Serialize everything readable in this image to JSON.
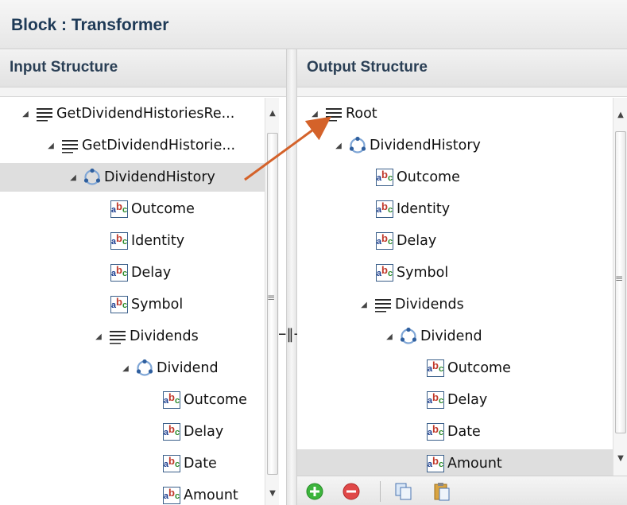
{
  "block": {
    "title": "Block : Transformer"
  },
  "input": {
    "header": "Input Structure",
    "nodes": [
      {
        "label": "GetDividendHistoriesRe...",
        "icon": "list-icon"
      },
      {
        "label": "GetDividendHistorie...",
        "icon": "list-icon"
      },
      {
        "label": "DividendHistory",
        "icon": "cycle-icon"
      },
      {
        "label": "Outcome",
        "icon": "abc-icon"
      },
      {
        "label": "Identity",
        "icon": "abc-icon"
      },
      {
        "label": "Delay",
        "icon": "abc-icon"
      },
      {
        "label": "Symbol",
        "icon": "abc-icon"
      },
      {
        "label": "Dividends",
        "icon": "list-icon"
      },
      {
        "label": "Dividend",
        "icon": "cycle-icon"
      },
      {
        "label": "Outcome",
        "icon": "abc-icon"
      },
      {
        "label": "Delay",
        "icon": "abc-icon"
      },
      {
        "label": "Date",
        "icon": "abc-icon"
      },
      {
        "label": "Amount",
        "icon": "abc-icon"
      }
    ]
  },
  "output": {
    "header": "Output Structure",
    "nodes": [
      {
        "label": "Root",
        "icon": "list-icon"
      },
      {
        "label": "DividendHistory",
        "icon": "cycle-icon"
      },
      {
        "label": "Outcome",
        "icon": "abc-icon"
      },
      {
        "label": "Identity",
        "icon": "abc-icon"
      },
      {
        "label": "Delay",
        "icon": "abc-icon"
      },
      {
        "label": "Symbol",
        "icon": "abc-icon"
      },
      {
        "label": "Dividends",
        "icon": "list-icon"
      },
      {
        "label": "Dividend",
        "icon": "cycle-icon"
      },
      {
        "label": "Outcome",
        "icon": "abc-icon"
      },
      {
        "label": "Delay",
        "icon": "abc-icon"
      },
      {
        "label": "Date",
        "icon": "abc-icon"
      },
      {
        "label": "Amount",
        "icon": "abc-icon"
      }
    ]
  },
  "toolbar": {
    "buttons": [
      "add-icon",
      "remove-icon",
      "copy-icon",
      "paste-icon"
    ]
  },
  "colors": {
    "mapping_arrow": "#d4622a",
    "header_text": "#2a3f55",
    "selection": "#dedede"
  }
}
